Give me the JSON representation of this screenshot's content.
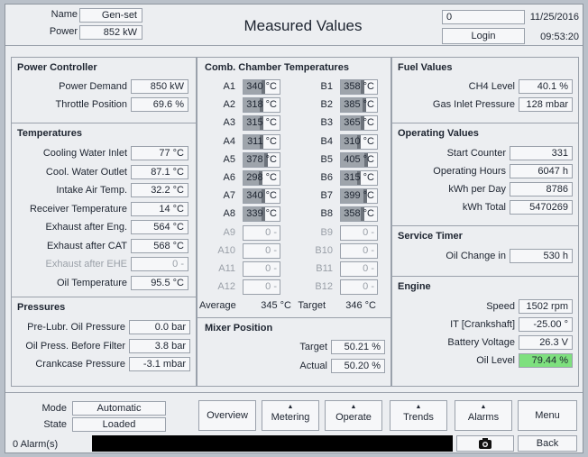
{
  "header": {
    "name_label": "Name",
    "name_value": "Gen-set",
    "power_label": "Power",
    "power_value": "852 kW",
    "title": "Measured Values",
    "counter": "0",
    "login": "Login",
    "date": "11/25/2016",
    "time": "09:53:20"
  },
  "power_controller": {
    "title": "Power Controller",
    "rows": [
      {
        "label": "Power Demand",
        "value": "850 kW"
      },
      {
        "label": "Throttle Position",
        "value": "69.6 %"
      }
    ]
  },
  "temperatures": {
    "title": "Temperatures",
    "rows": [
      {
        "label": "Cooling Water Inlet",
        "value": "77 °C"
      },
      {
        "label": "Cool. Water Outlet",
        "value": "87.1 °C"
      },
      {
        "label": "Intake Air Temp.",
        "value": "32.2 °C"
      },
      {
        "label": "Receiver Temperature",
        "value": "14 °C"
      },
      {
        "label": "Exhaust after Eng.",
        "value": "564 °C"
      },
      {
        "label": "Exhaust after CAT",
        "value": "568 °C"
      },
      {
        "label": "Exhaust after EHE",
        "value": "0 -"
      },
      {
        "label": "Oil Temperature",
        "value": "95.5 °C"
      }
    ]
  },
  "pressures": {
    "title": "Pressures",
    "rows": [
      {
        "label": "Pre-Lubr. Oil Pressure",
        "value": "0.0 bar"
      },
      {
        "label": "Oil Press. Before Filter",
        "value": "3.8 bar"
      },
      {
        "label": "Crankcase Pressure",
        "value": "-3.1 mbar"
      }
    ]
  },
  "comb_chamber": {
    "title": "Comb. Chamber Temperatures",
    "bank_a": [
      {
        "label": "A1",
        "value": "340 °C",
        "fill": 0.6
      },
      {
        "label": "A2",
        "value": "318 °C",
        "fill": 0.55
      },
      {
        "label": "A3",
        "value": "315 °C",
        "fill": 0.55
      },
      {
        "label": "A4",
        "value": "311 °C",
        "fill": 0.55
      },
      {
        "label": "A5",
        "value": "378 °C",
        "fill": 0.68
      },
      {
        "label": "A6",
        "value": "298 °C",
        "fill": 0.52
      },
      {
        "label": "A7",
        "value": "340 °C",
        "fill": 0.6
      },
      {
        "label": "A8",
        "value": "339 °C",
        "fill": 0.6
      },
      {
        "label": "A9",
        "value": "0 -",
        "fill": 0
      },
      {
        "label": "A10",
        "value": "0 -",
        "fill": 0
      },
      {
        "label": "A11",
        "value": "0 -",
        "fill": 0
      },
      {
        "label": "A12",
        "value": "0 -",
        "fill": 0
      }
    ],
    "bank_b": [
      {
        "label": "B1",
        "value": "358 °C",
        "fill": 0.64
      },
      {
        "label": "B2",
        "value": "385 °C",
        "fill": 0.7
      },
      {
        "label": "B3",
        "value": "365 °C",
        "fill": 0.66
      },
      {
        "label": "B4",
        "value": "310 °C",
        "fill": 0.55
      },
      {
        "label": "B5",
        "value": "405 °C",
        "fill": 0.74
      },
      {
        "label": "B6",
        "value": "315 °C",
        "fill": 0.55
      },
      {
        "label": "B7",
        "value": "399 °C",
        "fill": 0.72
      },
      {
        "label": "B8",
        "value": "358 °C",
        "fill": 0.64
      },
      {
        "label": "B9",
        "value": "0 -",
        "fill": 0
      },
      {
        "label": "B10",
        "value": "0 -",
        "fill": 0
      },
      {
        "label": "B11",
        "value": "0 -",
        "fill": 0
      },
      {
        "label": "B12",
        "value": "0 -",
        "fill": 0
      }
    ],
    "average_label": "Average",
    "average_value": "345 °C",
    "target_label": "Target",
    "target_value": "346 °C"
  },
  "mixer": {
    "title": "Mixer Position",
    "rows": [
      {
        "label": "Target",
        "value": "50.21 %"
      },
      {
        "label": "Actual",
        "value": "50.20 %"
      }
    ]
  },
  "fuel": {
    "title": "Fuel Values",
    "rows": [
      {
        "label": "CH4 Level",
        "value": "40.1 %"
      },
      {
        "label": "Gas Inlet Pressure",
        "value": "128 mbar"
      }
    ]
  },
  "operating": {
    "title": "Operating Values",
    "rows": [
      {
        "label": "Start Counter",
        "value": "331"
      },
      {
        "label": "Operating Hours",
        "value": "6047 h"
      },
      {
        "label": "kWh per Day",
        "value": "8786"
      },
      {
        "label": "kWh Total",
        "value": "5470269"
      }
    ]
  },
  "service": {
    "title": "Service Timer",
    "rows": [
      {
        "label": "Oil Change in",
        "value": "530 h"
      }
    ]
  },
  "engine": {
    "title": "Engine",
    "rows": [
      {
        "label": "Speed",
        "value": "1502 rpm"
      },
      {
        "label": "IT [Crankshaft]",
        "value": "-25.00 °"
      },
      {
        "label": "Battery Voltage",
        "value": "26.3 V"
      },
      {
        "label": "Oil Level",
        "value": "79.44 %"
      }
    ],
    "oil_level_color": "#7ee07e"
  },
  "footer": {
    "mode_label": "Mode",
    "mode_value": "Automatic",
    "state_label": "State",
    "state_value": "Loaded",
    "alarms": "0 Alarm(s)",
    "buttons": [
      "Overview",
      "Metering",
      "Operate",
      "Trends",
      "Alarms",
      "Menu"
    ],
    "back": "Back"
  }
}
